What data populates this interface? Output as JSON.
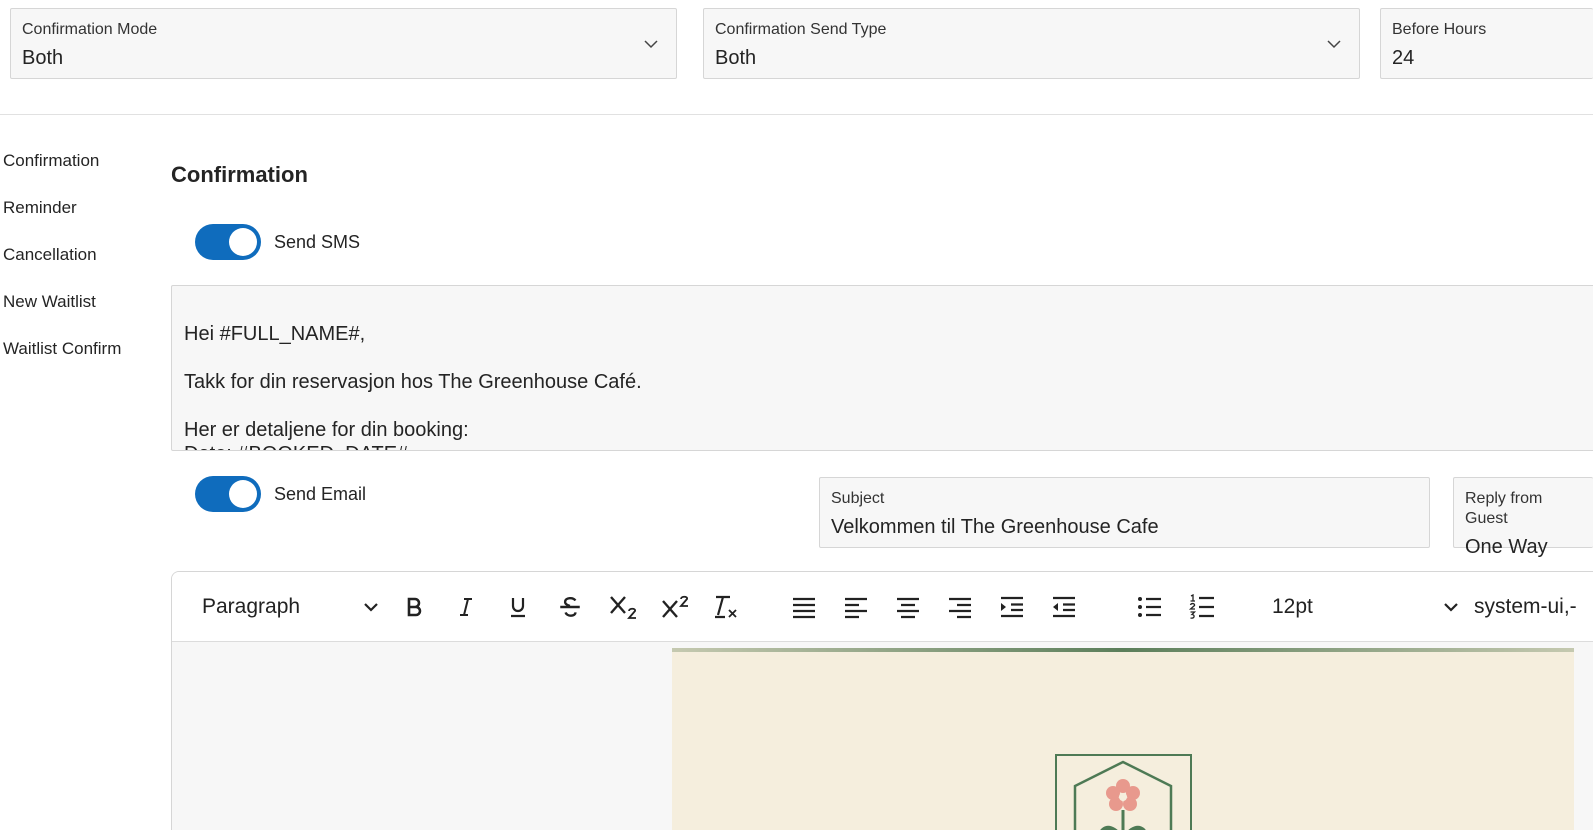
{
  "top_fields": {
    "confirmation_mode": {
      "label": "Confirmation Mode",
      "value": "Both"
    },
    "confirmation_send_type": {
      "label": "Confirmation Send Type",
      "value": "Both"
    },
    "before_hours": {
      "label": "Before Hours",
      "value": "24"
    }
  },
  "sidebar": {
    "items": [
      {
        "label": "Confirmation"
      },
      {
        "label": "Reminder"
      },
      {
        "label": "Cancellation"
      },
      {
        "label": "New Waitlist"
      },
      {
        "label": "Waitlist Confirm"
      }
    ]
  },
  "section": {
    "title": "Confirmation"
  },
  "sms": {
    "toggle_label": "Send SMS",
    "enabled": true,
    "lines": [
      "Hei #FULL_NAME#,",
      "Takk for din reservasjon hos The Greenhouse Café.",
      "Her er detaljene for din booking:",
      "Dato: #BOOKED_DATE#"
    ]
  },
  "email": {
    "toggle_label": "Send Email",
    "enabled": true,
    "subject": {
      "label": "Subject",
      "value": "Velkommen til The Greenhouse Cafe"
    },
    "reply": {
      "label": "Reply from Guest",
      "value": "One Way"
    }
  },
  "toolbar": {
    "block_format": "Paragraph",
    "font_size": "12pt",
    "font_family": "system-ui,-"
  },
  "colors": {
    "accent": "#0f6cbd",
    "preview_bg": "#f5eedd",
    "logo_green": "#4e7a55",
    "flower_pink": "#e8998d"
  }
}
